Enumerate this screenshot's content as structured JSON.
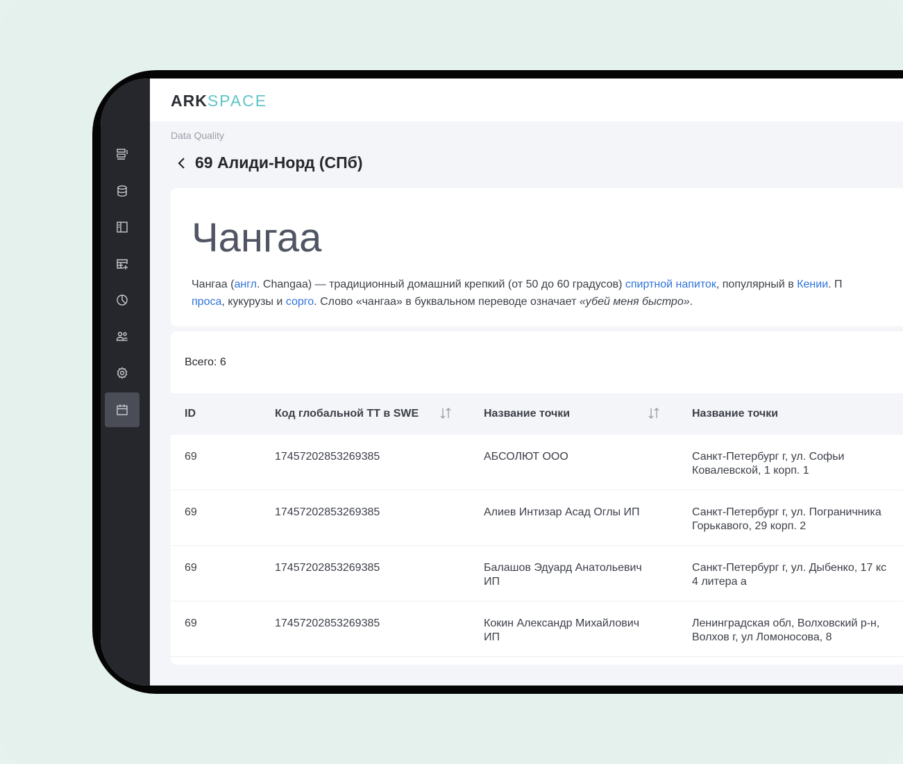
{
  "app": {
    "logo_part1": "ARK",
    "logo_part2": "SPACE"
  },
  "sidebar": {
    "items": [
      {
        "icon": "reports-icon",
        "active": false
      },
      {
        "icon": "database-icon",
        "active": false
      },
      {
        "icon": "book-icon",
        "active": false
      },
      {
        "icon": "table-add-icon",
        "active": false
      },
      {
        "icon": "pie-chart-icon",
        "active": false
      },
      {
        "icon": "users-icon",
        "active": false
      },
      {
        "icon": "gear-icon",
        "active": false
      },
      {
        "icon": "calendar-icon",
        "active": true
      }
    ]
  },
  "header": {
    "breadcrumb": "Data Quality",
    "title": "69 Алиди-Норд (СПб)"
  },
  "description": {
    "heading": "Чангаа",
    "line1_parts": [
      "Чангаа (",
      "англ",
      ". Changaa) — традиционный домашний крепкий (от 50 до 60 градусов) ",
      "спиртной напиток",
      ", популярный в ",
      "Кении",
      ". П"
    ],
    "line2_parts": [
      "проса",
      ", кукурузы и ",
      "сорго",
      ". Слово «чангаа» в буквальном переводе означает ",
      "«убей меня быстро»",
      "."
    ]
  },
  "table": {
    "total_label": "Всего: 6",
    "columns": [
      "ID",
      "Код глобальной ТТ в SWE",
      "Название точки",
      "Название точки"
    ],
    "rows": [
      [
        "69",
        "17457202853269385",
        "АБСОЛЮТ ООО",
        "Санкт-Петербург г, ул. Софьи\nКовалевской, 1 корп. 1"
      ],
      [
        "69",
        "17457202853269385",
        "Алиев Интизар Асад Оглы ИП",
        "Санкт-Петербург г, ул. Пограничника\nГорькавого, 29 корп. 2"
      ],
      [
        "69",
        "17457202853269385",
        "Балашов Эдуард Анатольевич\nИП",
        "Санкт-Петербург г, ул. Дыбенко, 17 кс\n4 литера а"
      ],
      [
        "69",
        "17457202853269385",
        "Кокин Александр Михайлович\nИП",
        "Ленинградская обл, Волховский р-н,\nВолхов г, ул Ломоносова, 8"
      ]
    ]
  },
  "colors": {
    "accent": "#5fc4c9",
    "link": "#2f73d9",
    "sidebar": "#25272c"
  }
}
